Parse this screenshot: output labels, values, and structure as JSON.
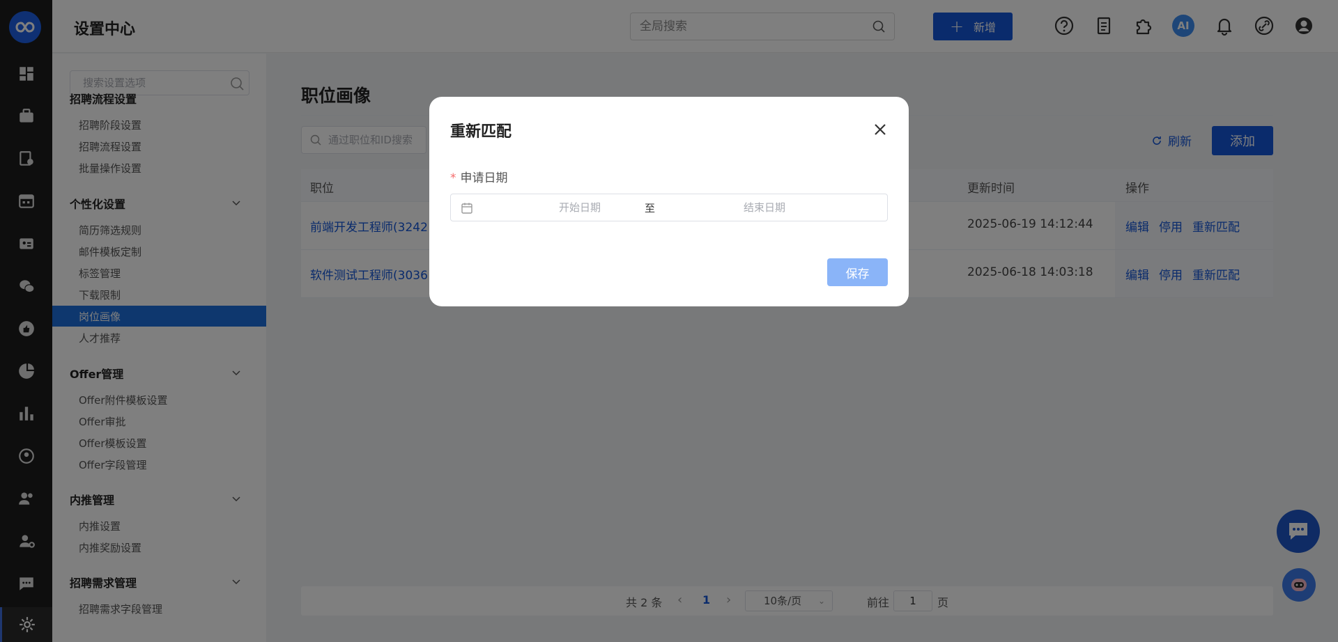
{
  "topbar": {
    "title": "设置中心",
    "search_placeholder": "全局搜索",
    "new_label": "新增",
    "ai_label": "AI"
  },
  "sidebar": {
    "search_placeholder": "搜索设置选项",
    "groups": [
      {
        "label": "招聘流程设置",
        "items": [
          "招聘阶段设置",
          "招聘流程设置",
          "批量操作设置"
        ]
      },
      {
        "label": "个性化设置",
        "items": [
          "简历筛选规则",
          "邮件模板定制",
          "标签管理",
          "下载限制",
          "岗位画像",
          "人才推荐"
        ]
      },
      {
        "label": "Offer管理",
        "items": [
          "Offer附件模板设置",
          "Offer审批",
          "Offer模板设置",
          "Offer字段管理"
        ]
      },
      {
        "label": "内推管理",
        "items": [
          "内推设置",
          "内推奖励设置"
        ]
      },
      {
        "label": "招聘需求管理",
        "items": [
          "招聘需求字段管理"
        ]
      }
    ],
    "active_item": "岗位画像"
  },
  "main": {
    "title": "职位画像",
    "search_placeholder": "通过职位和ID搜索",
    "refresh_label": "刷新",
    "add_label": "添加",
    "columns": {
      "position": "职位",
      "updated": "更新时间",
      "actions": "操作"
    },
    "rows": [
      {
        "position": "前端开发工程师(3242",
        "updated": "2025-06-19 14:12:44"
      },
      {
        "position": "软件测试工程师(3036",
        "updated": "2025-06-18 14:03:18"
      }
    ],
    "actions": {
      "edit": "编辑",
      "disable": "停用",
      "rematch": "重新匹配"
    }
  },
  "pagination": {
    "total": "共 2 条",
    "current_page": "1",
    "page_size": "10条/页",
    "goto_label": "前往",
    "goto_value": "1",
    "page_unit": "页"
  },
  "dialog": {
    "title": "重新匹配",
    "field_label": "申请日期",
    "required_mark": "*",
    "start_placeholder": "开始日期",
    "separator": "至",
    "end_placeholder": "结束日期",
    "save_label": "保存"
  },
  "colors": {
    "primary": "#1456d8",
    "sidebar_active": "#1c6edc",
    "save_disabled": "#8ab4f8",
    "rail_bg": "#1c1c1c",
    "required": "#f56c6c"
  }
}
